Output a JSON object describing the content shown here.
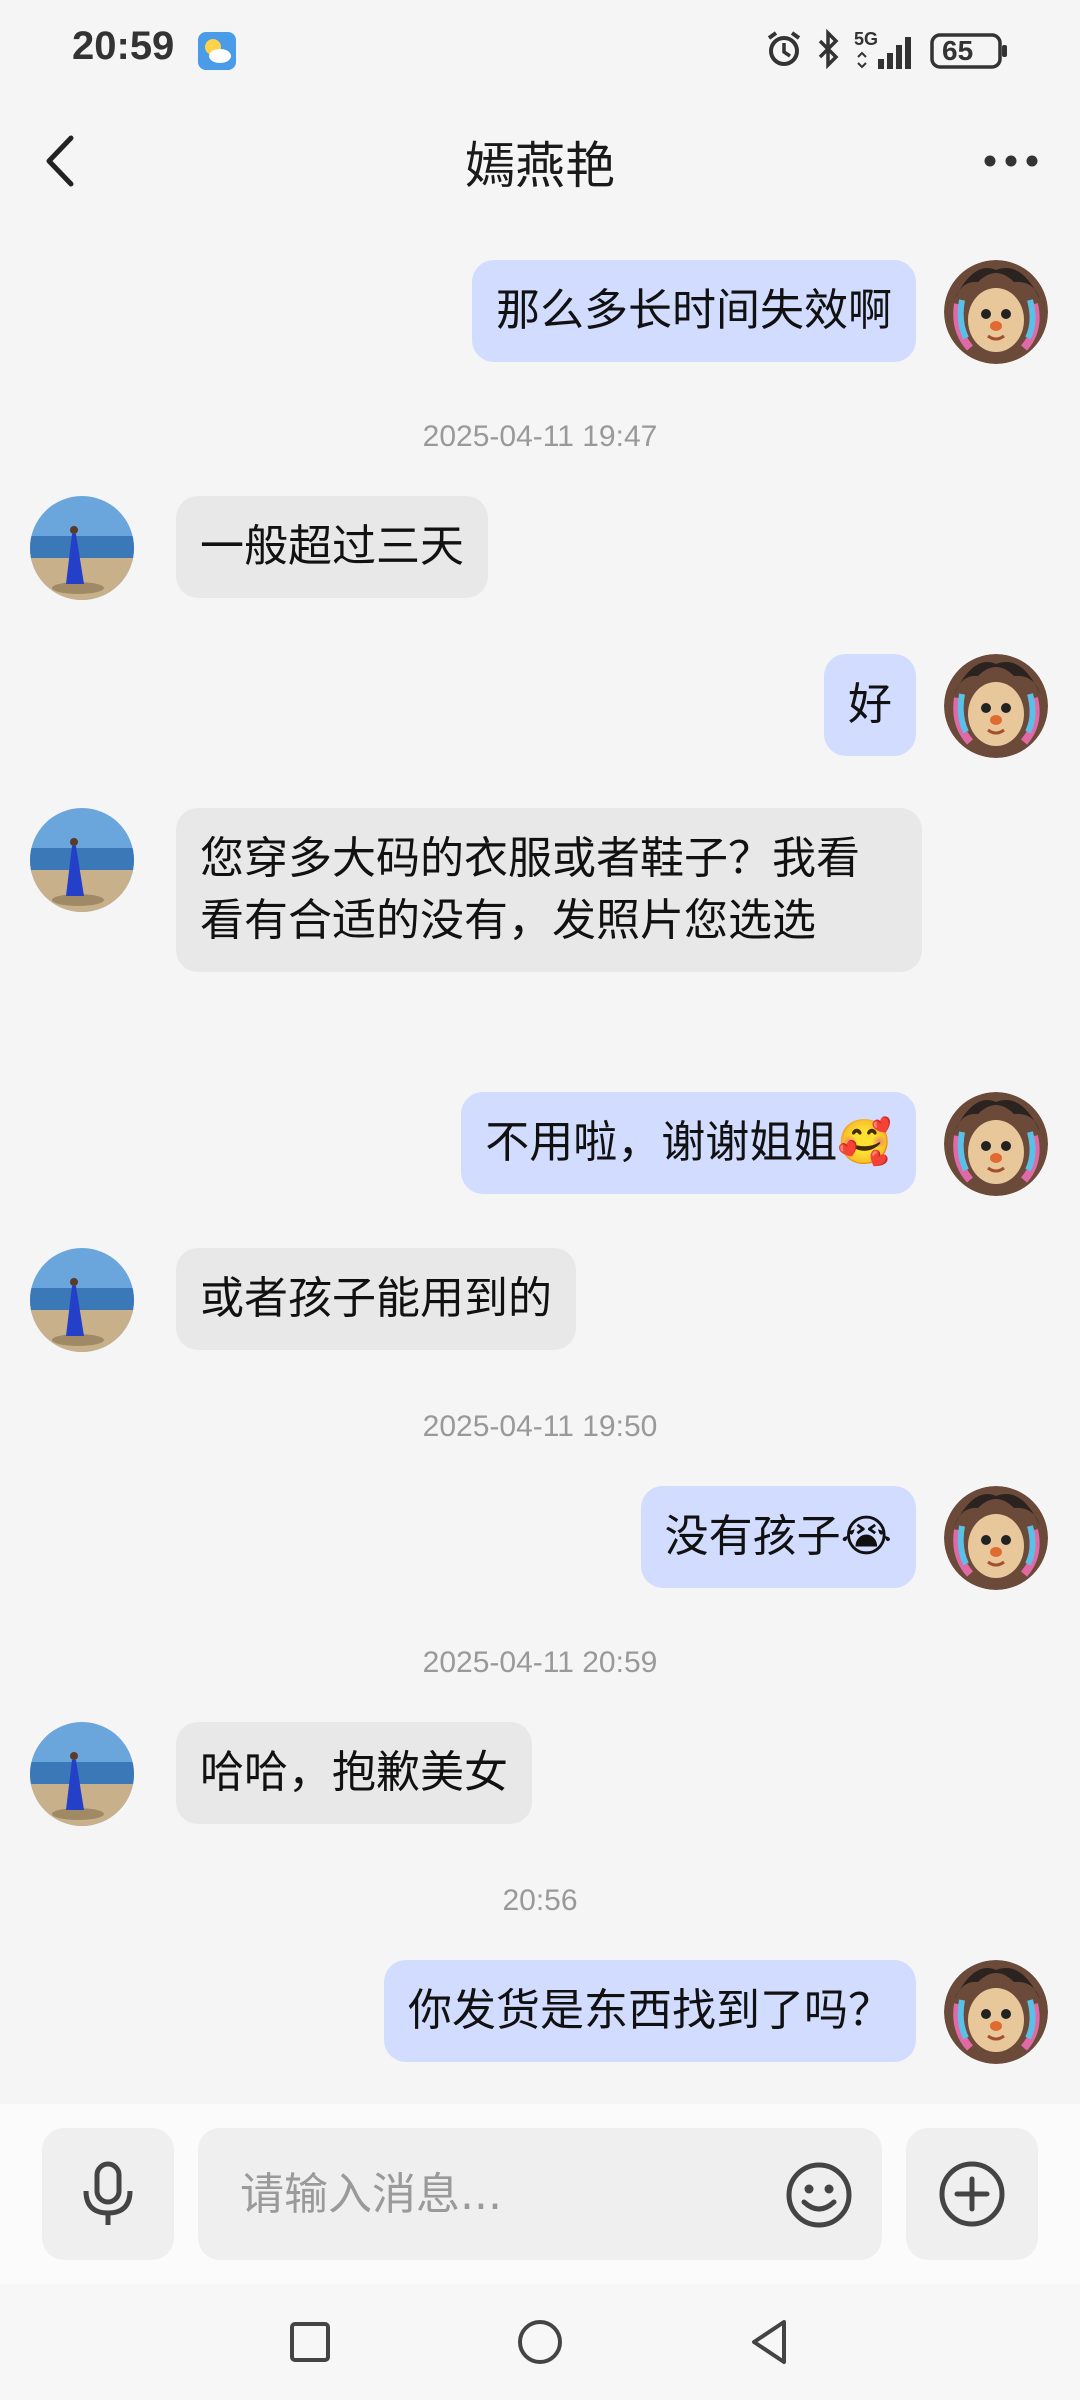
{
  "status_bar": {
    "time": "20:59",
    "network": "5G",
    "battery": "65"
  },
  "header": {
    "title": "嫣燕艳"
  },
  "messages": [
    {
      "type": "message",
      "side": "out",
      "text": "那么多长时间失效啊"
    },
    {
      "type": "timestamp",
      "text": "2025-04-11 19:47"
    },
    {
      "type": "message",
      "side": "in",
      "text": "一般超过三天"
    },
    {
      "type": "message",
      "side": "out",
      "text": "好"
    },
    {
      "type": "message",
      "side": "in",
      "text": "您穿多大码的衣服或者鞋子？我看看有合适的没有，发照片您选选"
    },
    {
      "type": "message",
      "side": "out",
      "text": "不用啦，谢谢姐姐",
      "emoji": "🥰"
    },
    {
      "type": "message",
      "side": "in",
      "text": "或者孩子能用到的"
    },
    {
      "type": "timestamp",
      "text": "2025-04-11 19:50"
    },
    {
      "type": "message",
      "side": "out",
      "text": "没有孩子",
      "emoji": "😭"
    },
    {
      "type": "timestamp",
      "text": "2025-04-11 20:59"
    },
    {
      "type": "message",
      "side": "in",
      "text": "哈哈，抱歉美女"
    },
    {
      "type": "timestamp",
      "text": "20:56"
    },
    {
      "type": "message",
      "side": "out",
      "text": "你发货是东西找到了吗？"
    }
  ],
  "input": {
    "placeholder": "请输入消息..."
  },
  "colors": {
    "outgoing_bubble": "#d2dcff",
    "incoming_bubble": "#e8e8e8",
    "background": "#f5f5f5"
  },
  "icons": {
    "back": "chevron-left-icon",
    "more": "more-dots-icon",
    "voice": "microphone-icon",
    "emoji": "smiley-icon",
    "plus": "plus-circle-icon"
  }
}
